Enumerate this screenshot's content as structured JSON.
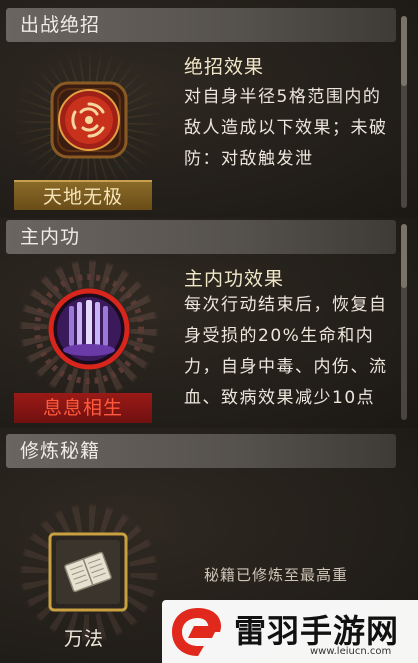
{
  "sections": {
    "ultimate": {
      "header": "出战绝招",
      "skill_name": "天地无极",
      "effect_title": "绝招效果",
      "effect_text": "对自身半径5格范围内的敌人造成以下效果；未破防：对敌触发泄"
    },
    "internal": {
      "header": "主内功",
      "skill_name": "息息相生",
      "effect_title": "主内功效果",
      "effect_text": "每次行动结束后，恢复自身受损的20%生命和内力，自身中毒、内伤、流血、致病效果减少10点"
    },
    "manual": {
      "header": "修炼秘籍",
      "skill_name": "万法",
      "status": "秘籍已修炼至最高重"
    }
  },
  "watermark": {
    "brand": "雷羽手游网",
    "url": "www.leiucn.com"
  },
  "colors": {
    "ultimate_name_bg": "#7a5a1e",
    "internal_name_bg": "#8a1414",
    "manual_name_bg": "#3c3730",
    "accent_red": "#e0281c"
  },
  "icons": {
    "ultimate": "red-swirl-icon",
    "internal": "purple-pillars-icon",
    "manual": "scroll-book-icon",
    "watermark": "brand-logo-icon"
  }
}
